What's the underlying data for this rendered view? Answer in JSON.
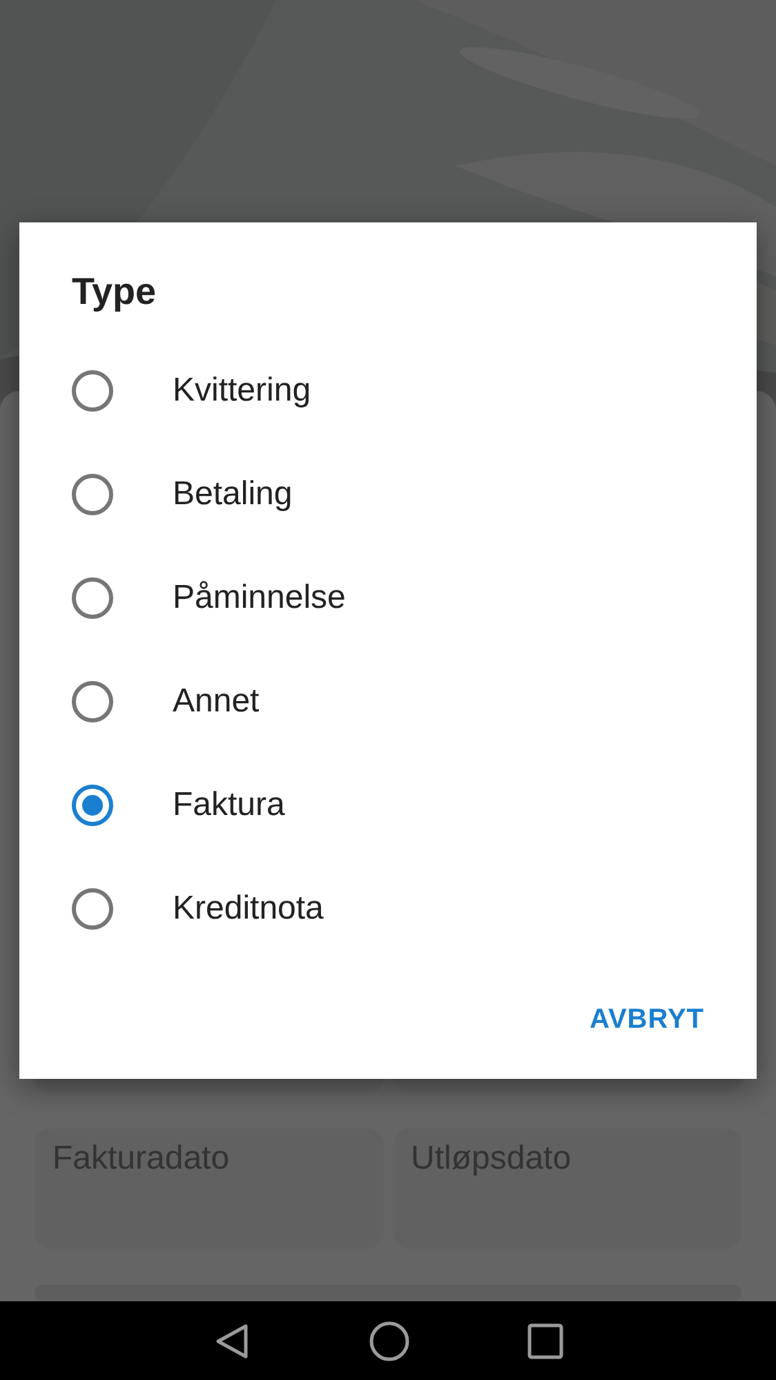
{
  "dialog": {
    "title": "Type",
    "options": [
      {
        "label": "Kvittering",
        "selected": false
      },
      {
        "label": "Betaling",
        "selected": false
      },
      {
        "label": "Påminnelse",
        "selected": false
      },
      {
        "label": "Annet",
        "selected": false
      },
      {
        "label": "Faktura",
        "selected": true
      },
      {
        "label": "Kreditnota",
        "selected": false
      }
    ],
    "cancel_button": "AVBRYT"
  },
  "form": {
    "date_fields": [
      {
        "placeholder": "Fakturadato"
      },
      {
        "placeholder": "Utløpsdato"
      }
    ]
  }
}
